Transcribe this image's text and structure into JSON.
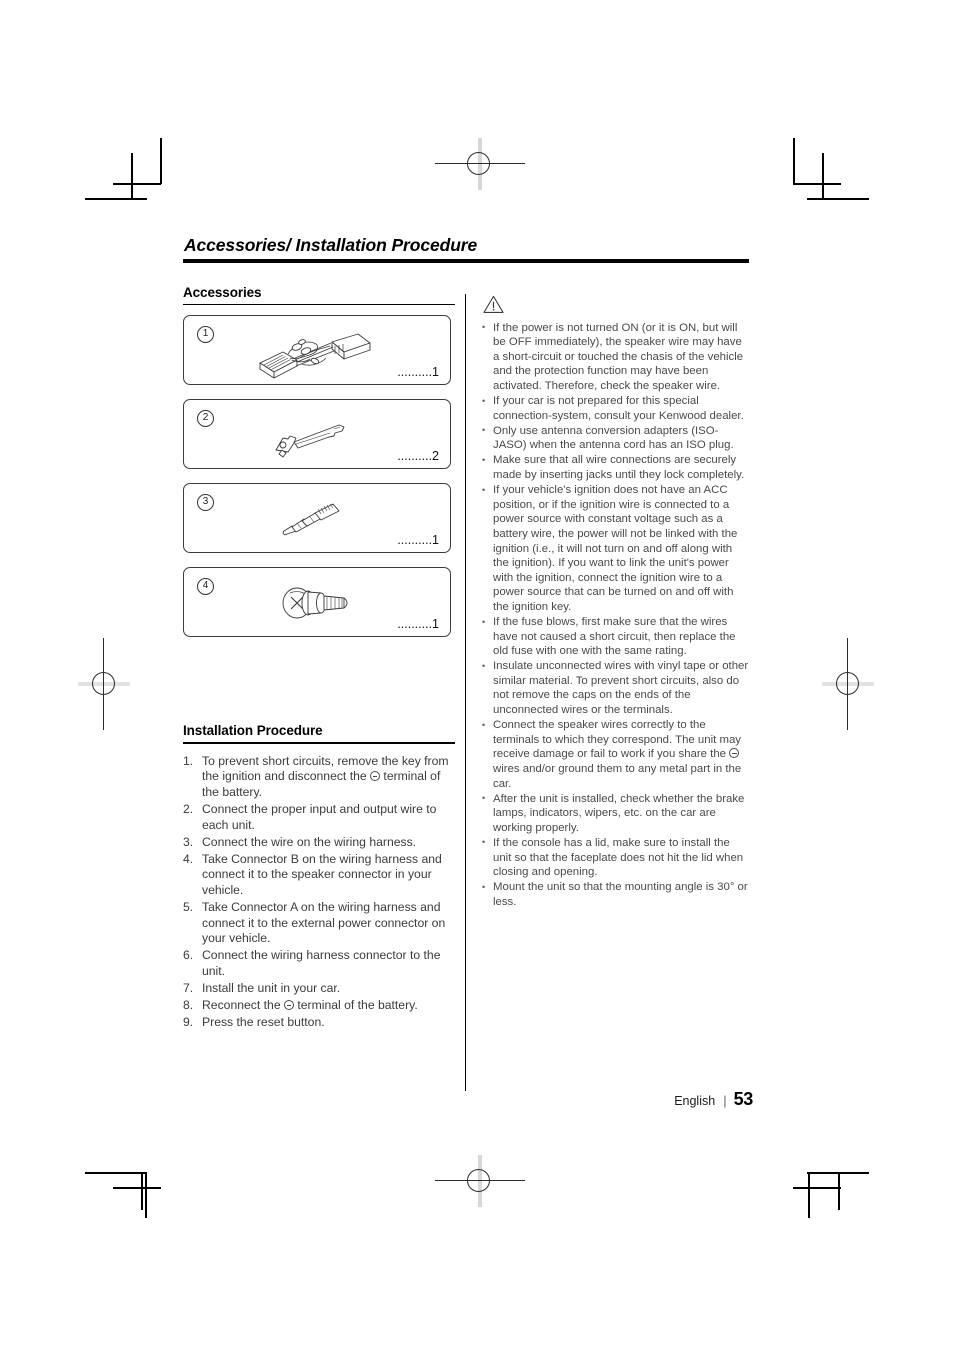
{
  "document": {
    "running_head": "Accessories/ Installation Procedure",
    "footer": {
      "language": "English",
      "separator": "|",
      "page_number": "53"
    }
  },
  "accessories": {
    "heading": "Accessories",
    "items": [
      {
        "number": "1",
        "icon": "wiring-harness-illustration",
        "leader": "..........",
        "qty": "1"
      },
      {
        "number": "2",
        "icon": "extraction-key-tool-illustration",
        "leader": "..........",
        "qty": "2"
      },
      {
        "number": "3",
        "icon": "antenna-conversion-adapter-illustration",
        "leader": "..........",
        "qty": "1"
      },
      {
        "number": "4",
        "icon": "screw-with-washer-illustration",
        "leader": "..........",
        "qty": "1"
      }
    ]
  },
  "installation": {
    "heading": "Installation Procedure",
    "steps": [
      "To prevent short circuits, remove the key from the ignition and disconnect the ⊝ terminal of the battery.",
      "Connect the proper input and output wire to each unit.",
      "Connect the wire on the wiring harness.",
      "Take Connector B on the wiring harness and connect it to the speaker connector in your vehicle.",
      "Take Connector A on the wiring harness and connect it to the external power connector on your vehicle.",
      "Connect the wiring harness connector to the unit.",
      "Install the unit in your car.",
      "Reconnect the ⊝ terminal of the battery.",
      "Press the reset button."
    ]
  },
  "warnings": {
    "icon": "warning-triangle-icon",
    "items": [
      "If the power is not turned ON (or it is ON, but will be OFF immediately), the speaker wire may have a short-circuit or touched the chasis of the vehicle and the protection function may have been activated. Therefore, check the speaker wire.",
      "If your car is not prepared for this special connection-system, consult your Kenwood dealer.",
      "Only use antenna conversion adapters (ISO-JASO) when the antenna cord has an ISO plug.",
      "Make sure that all wire connections are securely made by inserting jacks until they lock completely.",
      "If your vehicle's ignition does not have an ACC position, or if the ignition wire is connected to a power source with constant voltage such as a battery wire, the power will not be linked with the ignition (i.e., it will not turn on and off along with the ignition). If you want to link the unit's power with the ignition, connect the ignition wire to a power source that can be turned on and off with the ignition key.",
      "If the fuse blows, first make sure that the wires have not caused a short circuit, then replace the old fuse with one with the same rating.",
      "Insulate unconnected wires with vinyl tape or other similar material. To prevent short circuits, also do not remove the caps on the ends of the unconnected wires or the terminals.",
      "Connect the speaker wires correctly to the terminals to which they correspond. The unit may receive damage or fail to work if you share the ⊝ wires and/or ground them to any metal part in the car.",
      "After the unit is installed, check whether the brake lamps, indicators, wipers, etc. on the car are working properly.",
      "If the console has a lid, make sure to install the unit so that the faceplate does not hit the lid when closing and opening.",
      "Mount the unit so that the mounting angle is 30° or less."
    ]
  },
  "colors": {
    "ink": "#000000",
    "body_text": "#4a4a4a",
    "rule": "#000000"
  }
}
